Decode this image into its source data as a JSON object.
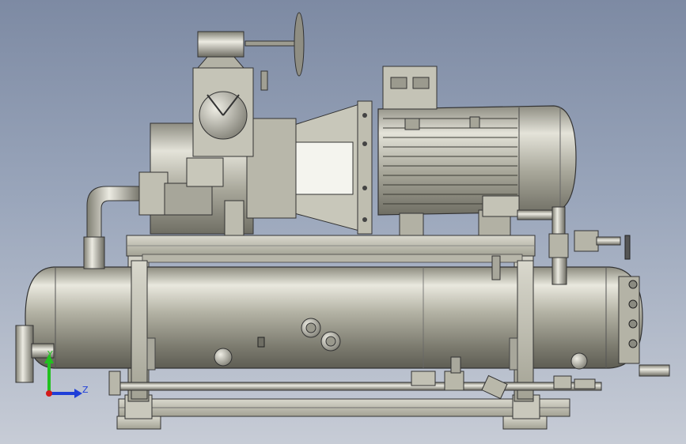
{
  "triad": {
    "y_label": "Y",
    "z_label": "Z",
    "y_color": "#22c01f",
    "z_color": "#1f3fd8",
    "origin_color": "#d41a1a"
  },
  "scene": {
    "background_top": "#7d8aa3",
    "background_bottom": "#c7ccd6",
    "metal_color": "#b9b8a8"
  }
}
